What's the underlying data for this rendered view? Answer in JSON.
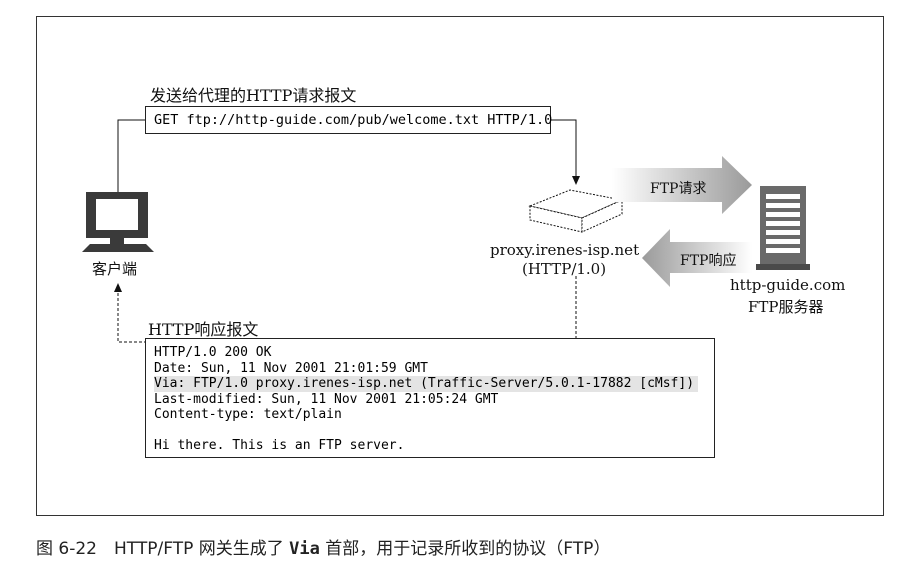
{
  "request": {
    "title": "发送给代理的HTTP请求报文",
    "line": "GET ftp://http-guide.com/pub/welcome.txt HTTP/1.0"
  },
  "client": {
    "label": "客户端"
  },
  "proxy": {
    "name": "proxy.irenes-isp.net",
    "version": "(HTTP/1.0)"
  },
  "ftp": {
    "request_label": "FTP请求",
    "response_label": "FTP响应"
  },
  "server": {
    "name": "http-guide.com",
    "role": "FTP服务器"
  },
  "response": {
    "title": "HTTP响应报文",
    "lines": [
      "HTTP/1.0 200 OK",
      "Date: Sun, 11 Nov 2001 21:01:59 GMT",
      "Via: FTP/1.0 proxy.irenes-isp.net (Traffic-Server/5.0.1-17882 [cMsf])",
      "Last-modified: Sun, 11 Nov 2001 21:05:24 GMT",
      "Content-type: text/plain",
      "",
      "Hi there. This is an FTP server."
    ]
  },
  "caption": {
    "prefix": "图 6-22　HTTP/FTP 网关生成了 ",
    "code": "Via",
    "suffix": " 首部，用于记录所收到的协议（FTP）"
  },
  "icons": [
    "computer-icon",
    "proxy-box-icon",
    "server-icon",
    "arrow-right-icon",
    "arrow-left-icon"
  ]
}
